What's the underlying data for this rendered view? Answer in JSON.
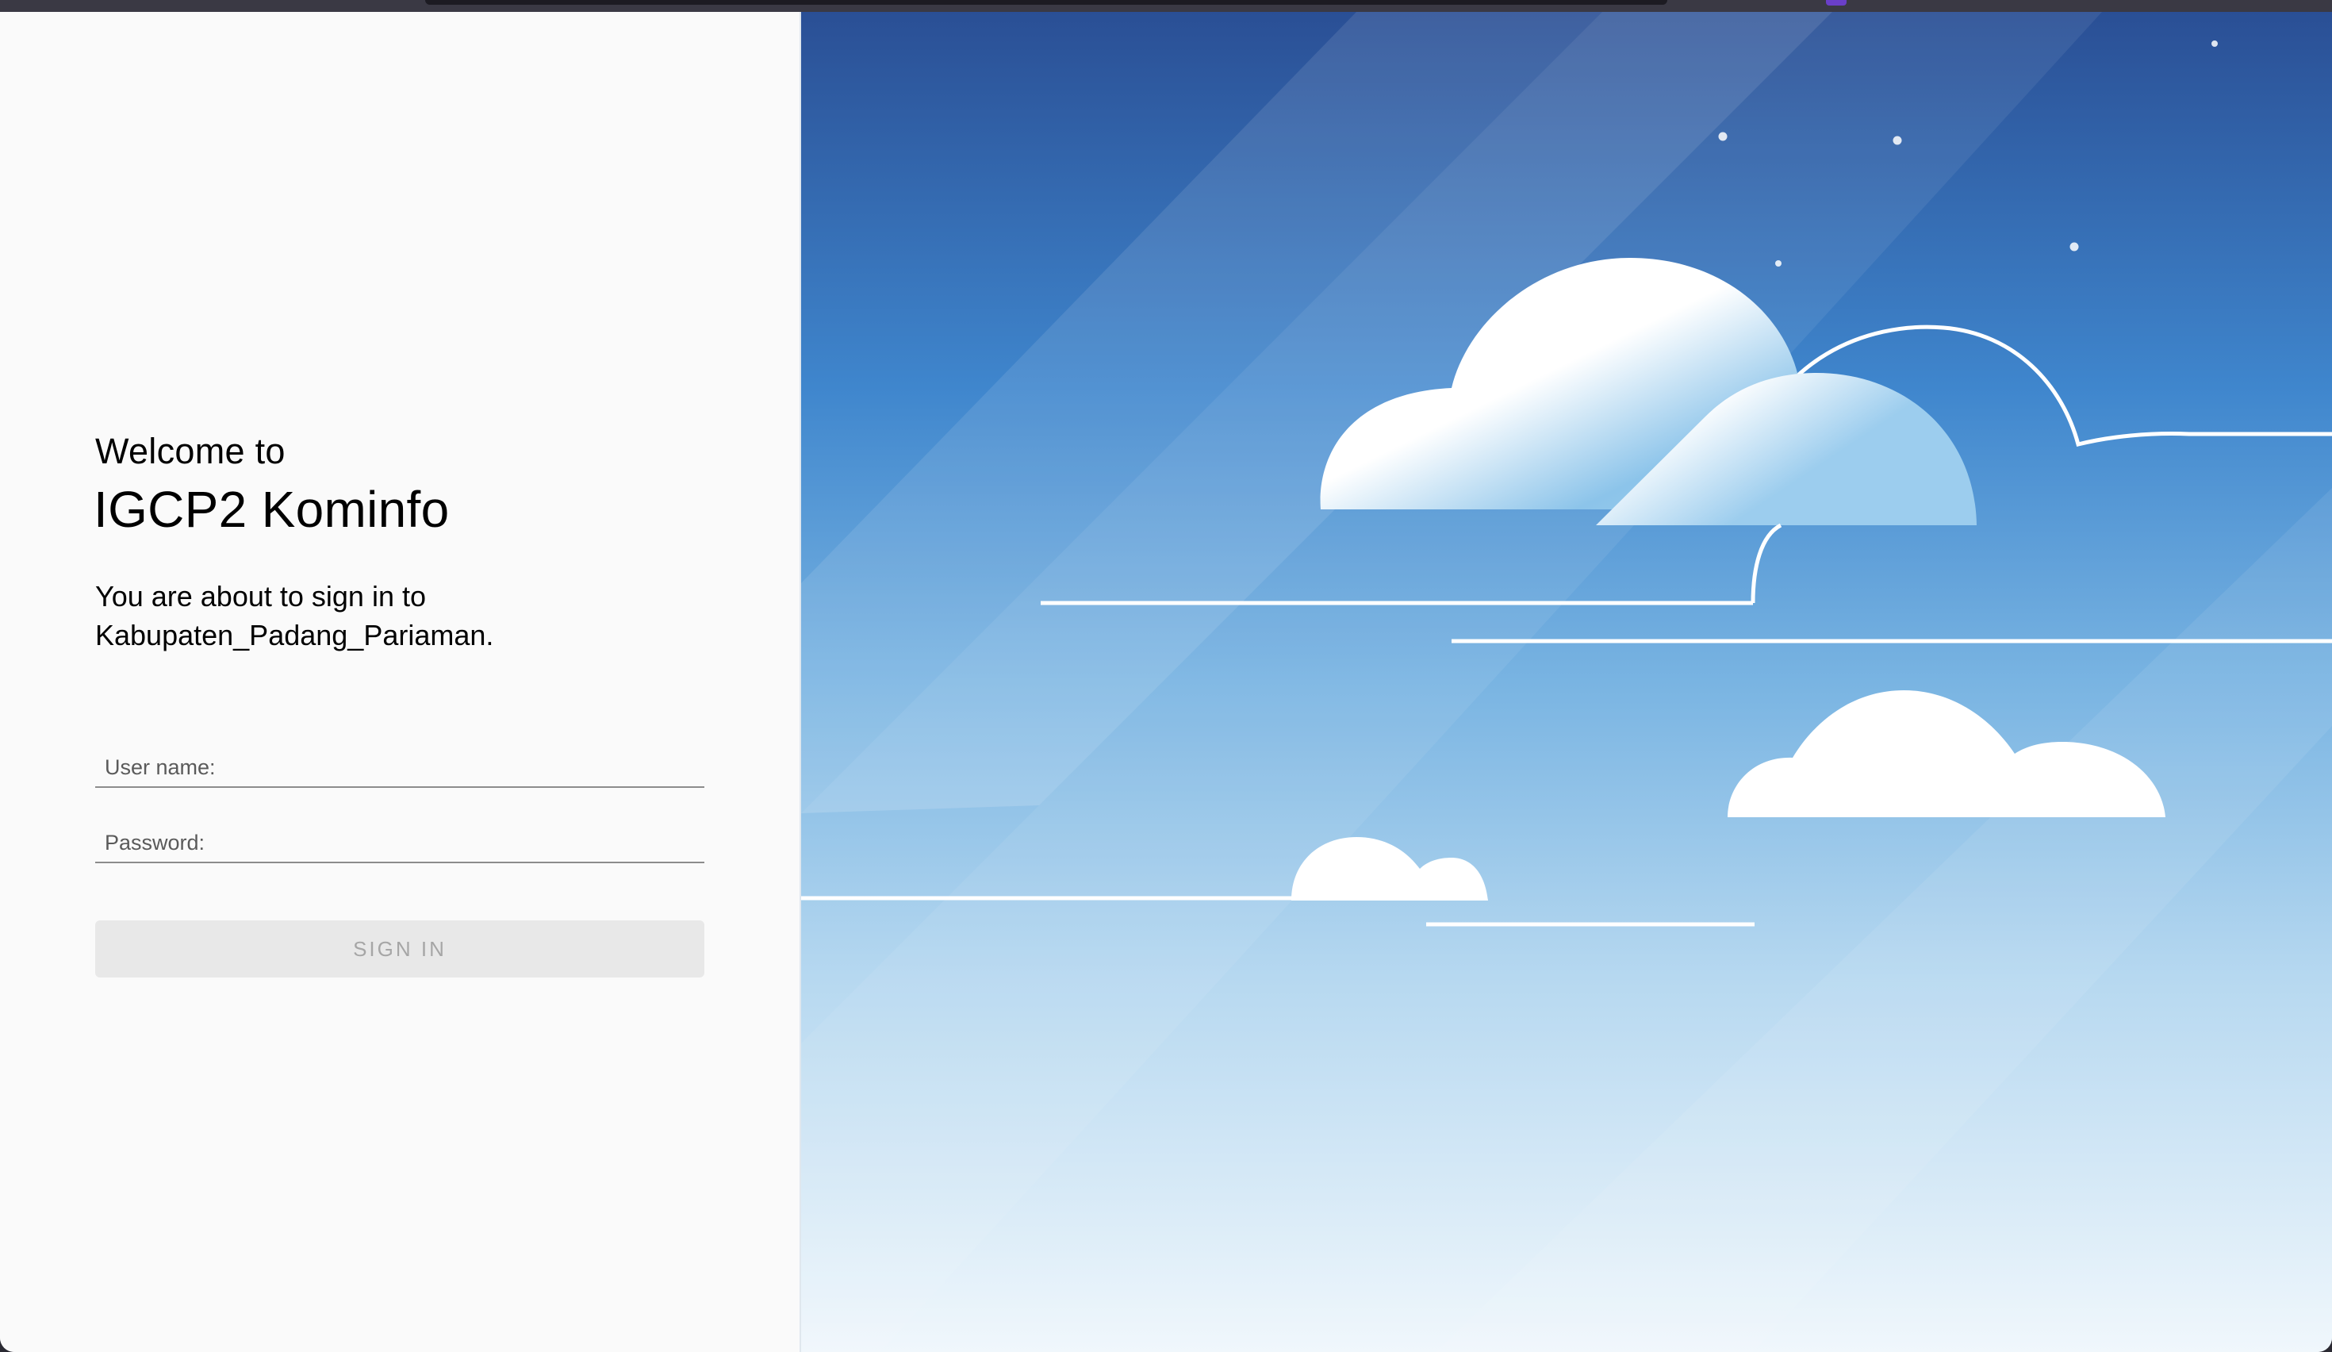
{
  "login": {
    "welcome": "Welcome to",
    "title": "IGCP2 Kominfo",
    "subtitle_line1": "You are about to sign in to",
    "subtitle_line2": "Kabupaten_Padang_Pariaman.",
    "username_placeholder": "User name:",
    "username_value": "",
    "password_placeholder": "Password:",
    "password_value": "",
    "signin_label": "SIGN IN"
  },
  "colors": {
    "sky_top": "#2a4f95",
    "sky_mid": "#5aa3da",
    "sky_bottom": "#f0f7fc",
    "button_bg": "#e8e8e8",
    "button_text": "#a6a6a6"
  },
  "icons": {
    "hero": "sky-clouds-illustration"
  }
}
